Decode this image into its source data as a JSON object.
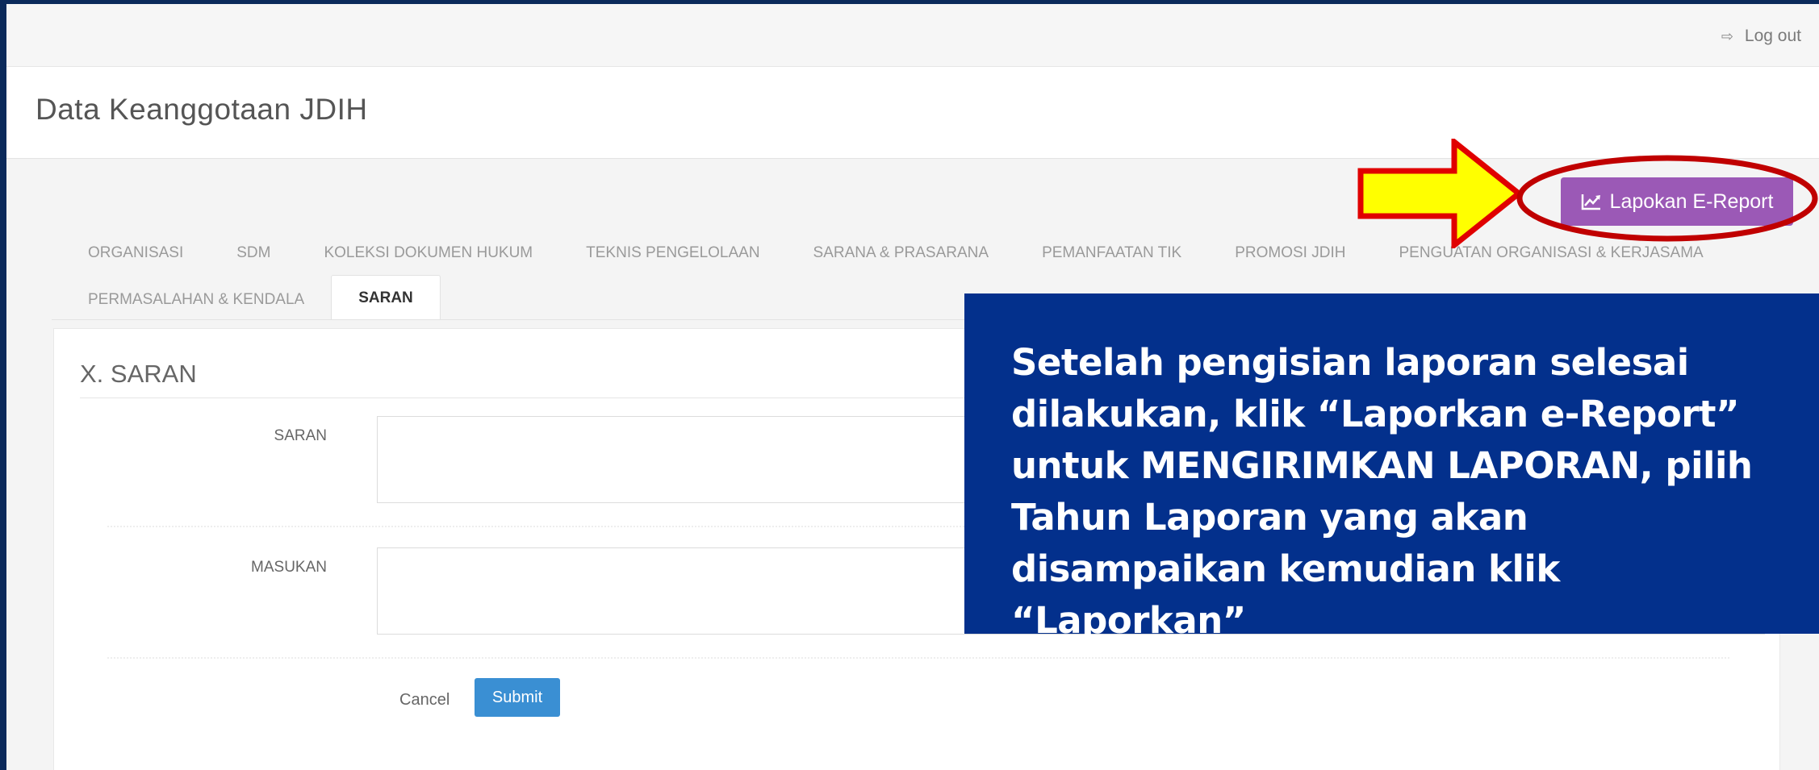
{
  "topbar": {
    "logout_label": "Log out",
    "logout_icon": "sign-out-icon"
  },
  "header": {
    "title": "Data Keanggotaan JDIH"
  },
  "actions": {
    "report_label": "Lapokan E-Report",
    "report_icon": "line-chart-icon",
    "report_color": "#9b59b6"
  },
  "tabs": {
    "row1": [
      {
        "label": "ORGANISASI"
      },
      {
        "label": "SDM"
      },
      {
        "label": "KOLEKSI DOKUMEN HUKUM"
      },
      {
        "label": "TEKNIS PENGELOLAAN"
      },
      {
        "label": "SARANA & PRASARANA"
      },
      {
        "label": "PEMANFAATAN TIK"
      },
      {
        "label": "PROMOSI JDIH"
      },
      {
        "label": "PENGUATAN ORGANISASI & KERJASAMA"
      }
    ],
    "row2": [
      {
        "label": "PERMASALAHAN & KENDALA"
      },
      {
        "label": "SARAN",
        "active": true
      }
    ]
  },
  "form": {
    "section_title": "X. SARAN",
    "fields": [
      {
        "label": "SARAN",
        "value": ""
      },
      {
        "label": "MASUKAN",
        "value": ""
      }
    ],
    "cancel_label": "Cancel",
    "submit_label": "Submit",
    "submit_color": "#3a8fd3"
  },
  "annotation": {
    "text": "Setelah pengisian laporan selesai dilakukan, klik “Laporkan e-Report” untuk MENGIRIMKAN LAPORAN, pilih Tahun Laporan yang akan disampaikan kemudian klik “Laporkan”",
    "box_color": "#03308c",
    "arrow_color": "#ffff00",
    "outline_color": "#e00000"
  }
}
